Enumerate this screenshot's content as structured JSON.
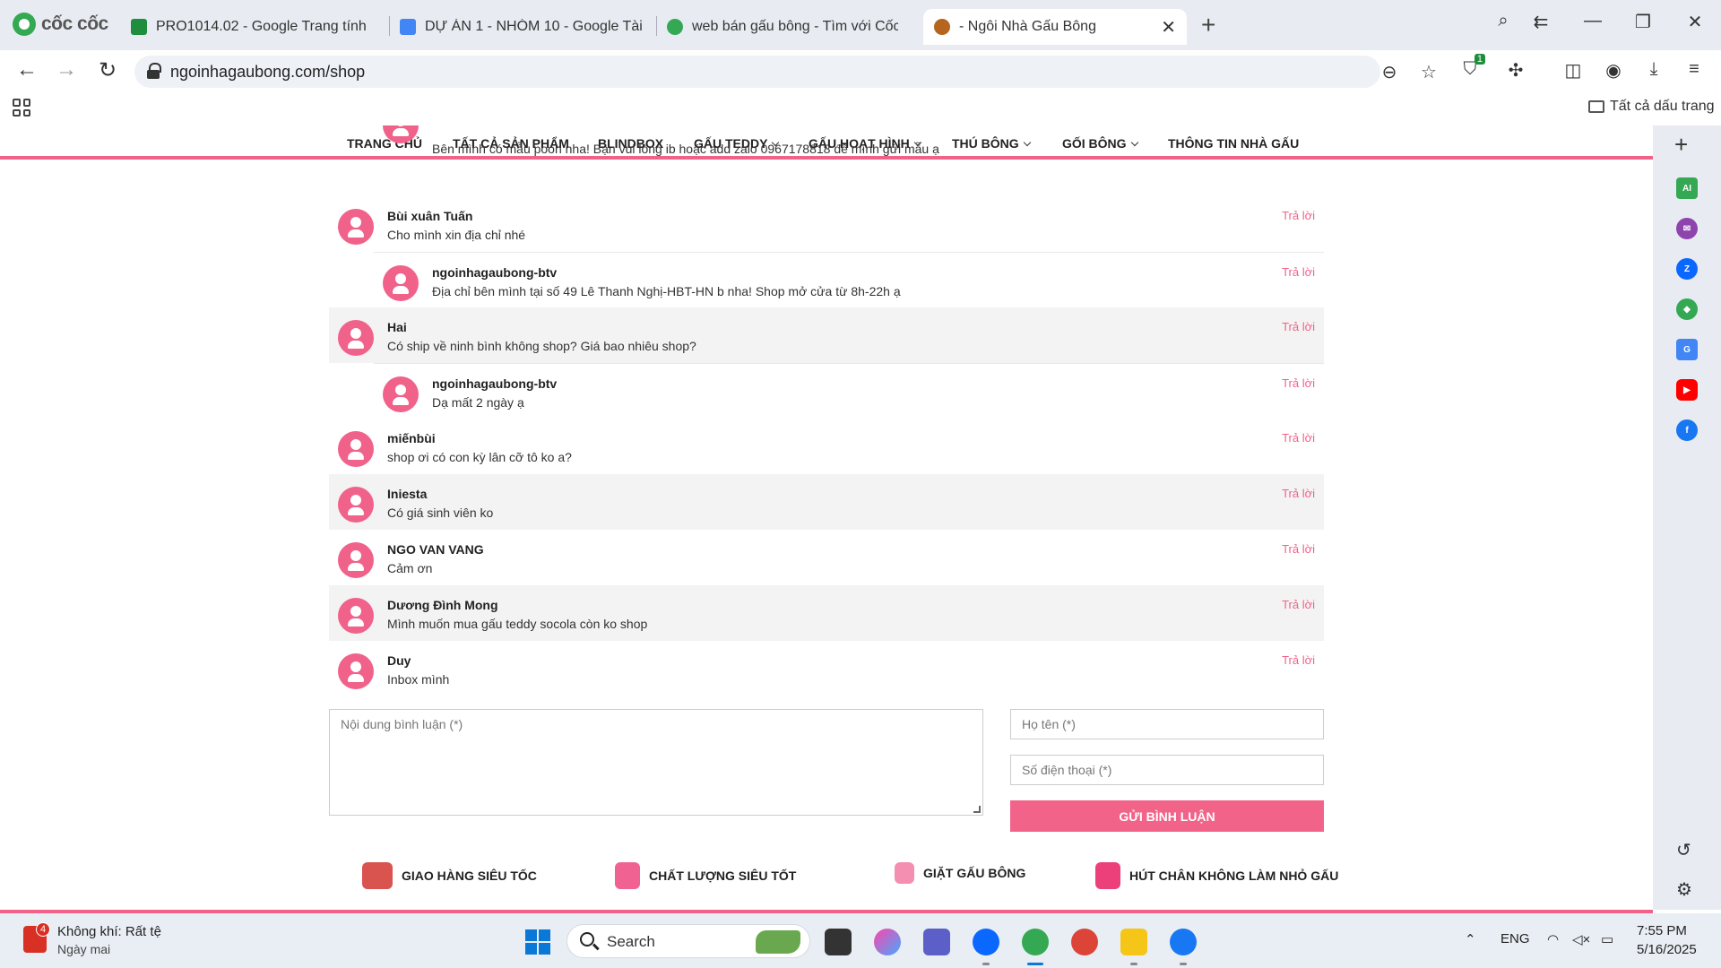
{
  "browser": {
    "brand": "cốc cốc",
    "tabs": [
      {
        "title": "PRO1014.02 - Google Trang tính",
        "icon": "sheets-icon"
      },
      {
        "title": "DỰ ÁN 1 - NHÓM 10 - Google Tài",
        "icon": "docs-icon"
      },
      {
        "title": "web bán gấu bông - Tìm với Cốc C",
        "icon": "coccoc-icon"
      },
      {
        "title": "- Ngôi Nhà Gấu Bông",
        "icon": "bear-icon",
        "active": true
      }
    ],
    "url": "ngoinhagaubong.com/shop",
    "extension_badge": "1",
    "bookmarks_all": "Tất cả dấu trang"
  },
  "site_nav": {
    "items": [
      {
        "label": "TRANG CHỦ",
        "dropdown": false
      },
      {
        "label": "TẤT CẢ SẢN PHẨM",
        "dropdown": false
      },
      {
        "label": "BLINDBOX",
        "dropdown": false
      },
      {
        "label": "GẤU TEDDY",
        "dropdown": true
      },
      {
        "label": "GẤU HOẠT HÌNH",
        "dropdown": true
      },
      {
        "label": "THÚ BÔNG",
        "dropdown": true
      },
      {
        "label": "GỐI BÔNG",
        "dropdown": true
      },
      {
        "label": "THÔNG TIN NHÀ GẤU",
        "dropdown": false
      }
    ]
  },
  "comments": {
    "reply_label": "Trả lời",
    "partial_top_text": "Bên mình có mẫu pooh nha! Bạn vui lòng ib hoặc add zalo 0967178818 để mình gửi mẫu ạ",
    "items": [
      {
        "name": "Bùi xuân Tuấn",
        "text": "Cho mình xin địa chỉ nhé",
        "reply": false,
        "shaded": false
      },
      {
        "name": "ngoinhagaubong-btv",
        "text": "Địa chỉ bên mình tại số 49 Lê Thanh Nghị-HBT-HN b nha! Shop mở cửa từ 8h-22h ạ",
        "reply": true,
        "shaded": false
      },
      {
        "name": "Hai",
        "text": "Có ship về ninh bình không shop? Giá bao nhiêu shop?",
        "reply": false,
        "shaded": true
      },
      {
        "name": "ngoinhagaubong-btv",
        "text": "Dạ mất 2 ngày ạ",
        "reply": true,
        "shaded": false
      },
      {
        "name": "miếnbùi",
        "text": "shop ơi có con kỳ lân cỡ tô ko a?",
        "reply": false,
        "shaded": false
      },
      {
        "name": "Iniesta",
        "text": "Có giá sinh viên ko",
        "reply": false,
        "shaded": true
      },
      {
        "name": "NGO VAN VANG",
        "text": "Cảm ơn",
        "reply": false,
        "shaded": false
      },
      {
        "name": "Dương Đình Mong",
        "text": "Mình muốn mua gấu teddy socola còn ko shop",
        "reply": false,
        "shaded": true
      },
      {
        "name": "Duy",
        "text": "Inbox mình",
        "reply": false,
        "shaded": false
      }
    ]
  },
  "form": {
    "content_placeholder": "Nội dung bình luận (*)",
    "name_placeholder": "Họ tên (*)",
    "phone_placeholder": "Số điện thoại (*)",
    "submit_label": "GỬI BÌNH LUẬN"
  },
  "features": [
    {
      "label": "GIAO HÀNG SIÊU TỐC",
      "icon": "delivery-truck-icon",
      "color": "#d9534f"
    },
    {
      "label": "CHẤT LƯỢNG SIÊU TỐT",
      "icon": "shopping-bag-icon",
      "color": "#f06292"
    },
    {
      "label": "GIẶT GẤU BÔNG",
      "icon": "washing-machine-icon",
      "color": "#f48fb1"
    },
    {
      "label": "HÚT CHÂN KHÔNG LÀM NHỎ GẤU",
      "icon": "vacuum-icon",
      "color": "#ec407a"
    }
  ],
  "taskbar": {
    "weather_badge": "4",
    "weather_title": "Không khí: Rất tệ",
    "weather_sub": "Ngày mai",
    "search_label": "Search",
    "language": "ENG",
    "time": "7:55 PM",
    "date": "5/16/2025"
  },
  "colors": {
    "accent_pink": "#f0628a",
    "submit_pink": "#f26389",
    "browser_chrome": "#e8ecf2"
  }
}
